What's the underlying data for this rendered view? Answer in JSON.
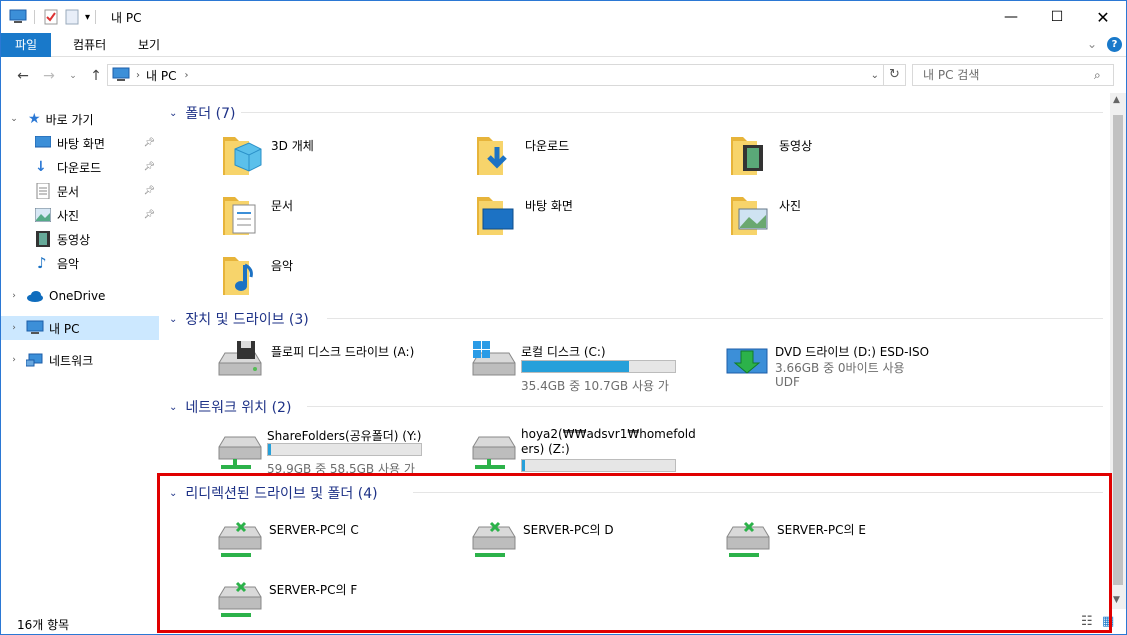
{
  "window": {
    "title": "내 PC"
  },
  "ribbon": {
    "tabs": [
      "파일",
      "컴퓨터",
      "보기"
    ]
  },
  "address": {
    "path_root": "내 PC",
    "search_placeholder": "내 PC 검색"
  },
  "sidebar": {
    "quick_access": "바로 가기",
    "quick_items": [
      "바탕 화면",
      "다운로드",
      "문서",
      "사진",
      "동영상",
      "음악"
    ],
    "onedrive": "OneDrive",
    "mypc": "내 PC",
    "network": "네트워크"
  },
  "groups": {
    "folders": {
      "title": "폴더 (7)",
      "items": [
        "3D 개체",
        "다운로드",
        "동영상",
        "문서",
        "바탕 화면",
        "사진",
        "음악"
      ]
    },
    "drives": {
      "title": "장치 및 드라이브 (3)",
      "floppy": {
        "label": "플로피 디스크 드라이브 (A:)"
      },
      "local": {
        "label": "로컬 디스크 (C:)",
        "free": "35.4GB 중 10.7GB 사용 가",
        "used_fraction": 0.7
      },
      "dvd": {
        "label": "DVD 드라이브 (D:) ESD-ISO",
        "free": "3.66GB 중 0바이트 사용",
        "fs": "UDF"
      }
    },
    "network": {
      "title": "네트워크 위치 (2)",
      "share": {
        "label": "ShareFolders(공유폴더) (Y:)",
        "free": "59.9GB 중 58.5GB 사용 가",
        "used_fraction": 0.02
      },
      "hoya": {
        "label1": "hoya2(₩₩adsvr1₩homefold",
        "label2": "ers) (Z:)",
        "used_fraction": 0.02
      }
    },
    "redirected": {
      "title": "리디렉션된 드라이브 및 폴더 (4)",
      "items": [
        "SERVER-PC의 C",
        "SERVER-PC의 D",
        "SERVER-PC의 E",
        "SERVER-PC의 F"
      ]
    }
  },
  "status": {
    "count": "16개 항목"
  }
}
